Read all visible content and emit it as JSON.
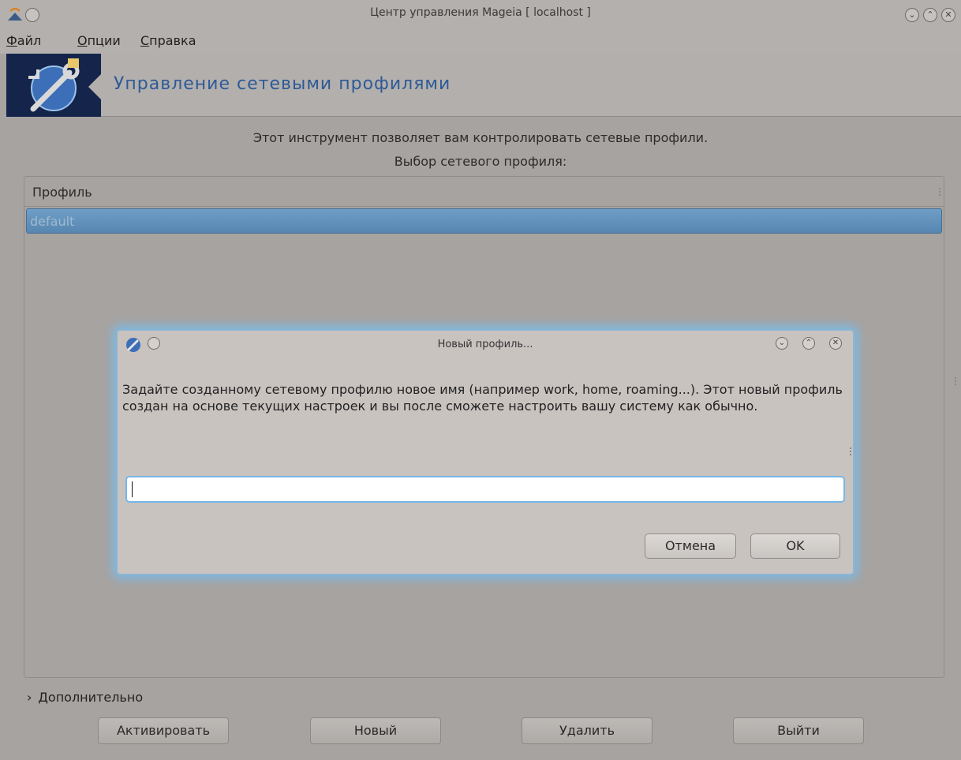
{
  "window": {
    "title": "Центр управления Mageia  [ localhost ]",
    "controls": [
      "minimize-icon",
      "maximize-icon",
      "close-icon"
    ]
  },
  "menu": {
    "file": {
      "mnemonic": "Ф",
      "rest": "айл"
    },
    "options": {
      "mnemonic": "О",
      "rest": "пции"
    },
    "help": {
      "mnemonic": "С",
      "rest": "правка"
    }
  },
  "banner": {
    "heading": "Управление сетевыми профилями"
  },
  "description": {
    "line1": "Этот инструмент позволяет вам контролировать сетевые профили.",
    "line2": "Выбор сетевого профиля:"
  },
  "profile_list": {
    "column_header": "Профиль",
    "rows": [
      "default"
    ]
  },
  "advanced": {
    "label": "Дополнительно",
    "expander_icon": "chevron-right-icon"
  },
  "buttons": {
    "activate": "Активировать",
    "new": "Новый",
    "delete": "Удалить",
    "exit": "Выйти"
  },
  "dialog": {
    "title": "Новый профиль...",
    "message": "Задайте созданному сетевому профилю новое имя (например work, home, roaming...). Этот новый профиль создан на основе текущих настроек и вы после сможете настроить вашу систему как обычно.",
    "input_value": "",
    "cancel": "Отмена",
    "ok": "OK"
  },
  "colors": {
    "selection": "#5f8fb9",
    "heading": "#2e5a97",
    "dialog_glow": "#76bef0"
  }
}
